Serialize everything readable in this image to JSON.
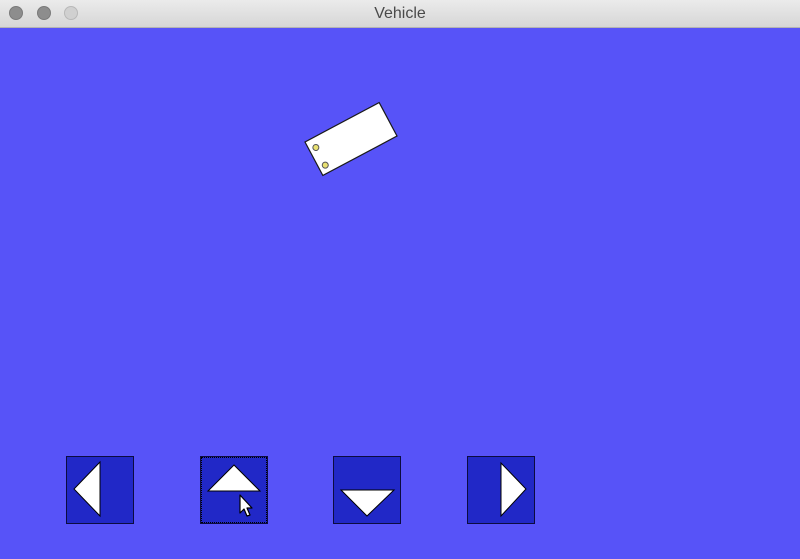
{
  "window": {
    "title": "Vehicle",
    "background_color": "#5753f8"
  },
  "titlebar": {
    "buttons": [
      {
        "name": "close-button"
      },
      {
        "name": "minimize-button"
      },
      {
        "name": "zoom-button"
      }
    ]
  },
  "vehicle": {
    "rotation_deg": -28,
    "body_color": "#ffffff",
    "light_color": "#e8e070"
  },
  "controls": {
    "button_color": "#2128c7",
    "arrow_color": "#ffffff",
    "items": [
      {
        "name": "left-button",
        "icon": "triangle-left-icon"
      },
      {
        "name": "up-button",
        "icon": "triangle-up-icon",
        "focused": true
      },
      {
        "name": "down-button",
        "icon": "triangle-down-icon"
      },
      {
        "name": "right-button",
        "icon": "triangle-right-icon"
      }
    ]
  },
  "cursor": {
    "icon": "arrow-pointer-icon"
  }
}
